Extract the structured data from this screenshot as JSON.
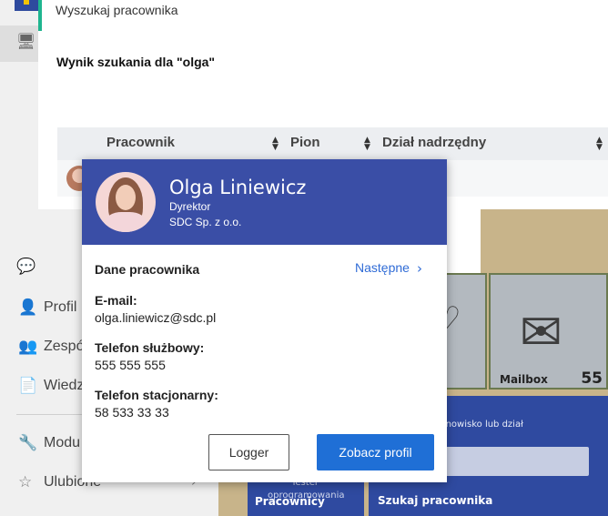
{
  "sidebar": {
    "items": [
      {
        "label": "Profil",
        "icon": "person-icon"
      },
      {
        "label": "Zespó",
        "icon": "team-icon"
      },
      {
        "label": "Wiedz",
        "icon": "knowledge-icon"
      },
      {
        "label": "Modu",
        "icon": "wrench-icon"
      },
      {
        "label": "Ulubione",
        "icon": "star-icon"
      }
    ]
  },
  "search_panel": {
    "title": "Wyszukaj pracownika",
    "result_text": "Wynik szukania dla \"olga\"",
    "columns": [
      "Pracownik",
      "Pion",
      "Dział nadrzędny"
    ]
  },
  "tiles": {
    "mailbox_label": "Mailbox",
    "mailbox_count": "55",
    "search_hint": "zwisko, stanowisko lub dział",
    "search_button": "Szukaj pracownika",
    "tile2_line1": "Tester",
    "tile2_line2": "oprogramowania",
    "tile2_title": "Pracownicy"
  },
  "card": {
    "name": "Olga Liniewicz",
    "role": "Dyrektor",
    "company": "SDC Sp. z o.o.",
    "section_title": "Dane pracownika",
    "next_label": "Następne",
    "fields": [
      {
        "label": "E-mail:",
        "value": "olga.liniewicz@sdc.pl"
      },
      {
        "label": "Telefon służbowy:",
        "value": "555 555 555"
      },
      {
        "label": "Telefon stacjonarny:",
        "value": "58 533 33 33"
      }
    ],
    "logger_button": "Logger",
    "profile_button": "Zobacz profil"
  },
  "colors": {
    "card_header": "#3a4ea6",
    "primary_button": "#1f6fd6",
    "link": "#2f6bd6",
    "accent": "#1fb58f"
  }
}
